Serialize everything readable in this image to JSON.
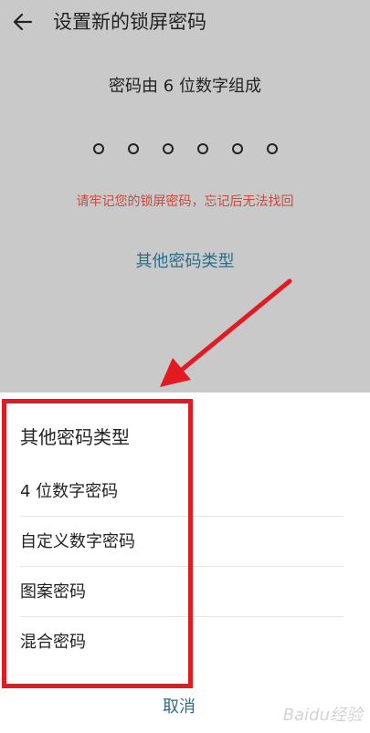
{
  "header": {
    "title": "设置新的锁屏密码"
  },
  "main": {
    "subtitle": "密码由 6 位数字组成",
    "pin_dot_count": 6,
    "warning": "请牢记您的锁屏密码，忘记后无法找回",
    "other_types_link": "其他密码类型"
  },
  "sheet": {
    "title": "其他密码类型",
    "options": [
      "4 位数字密码",
      "自定义数字密码",
      "图案密码",
      "混合密码"
    ],
    "cancel": "取消"
  },
  "watermark": "Baidu经验",
  "colors": {
    "warning": "#c84b3f",
    "link": "#2d6d86",
    "annotation_red": "#e21a22",
    "dim_overlay": "#c9c9c9"
  }
}
